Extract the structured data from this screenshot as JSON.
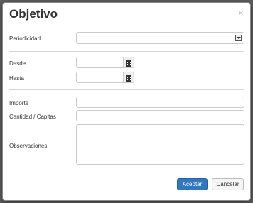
{
  "dialog": {
    "title": "Objetivo",
    "close_symbol": "×"
  },
  "form": {
    "periodicidad_label": "Periodicidad",
    "periodicidad_value": "",
    "desde_label": "Desde",
    "desde_value": "",
    "hasta_label": "Hasta",
    "hasta_value": "",
    "importe_label": "Importe",
    "importe_value": "",
    "cantidad_label": "Cantidad / Capitas",
    "cantidad_value": "",
    "observaciones_label": "Observaciones",
    "observaciones_value": ""
  },
  "footer": {
    "accept_label": "Aceptar",
    "cancel_label": "Cancelar"
  },
  "icons": {
    "dropdown": "chevron-down-icon",
    "calendar": "calendar-icon",
    "close": "close-icon"
  },
  "colors": {
    "primary": "#2f79c2",
    "backdrop": "#5f5f5f"
  }
}
